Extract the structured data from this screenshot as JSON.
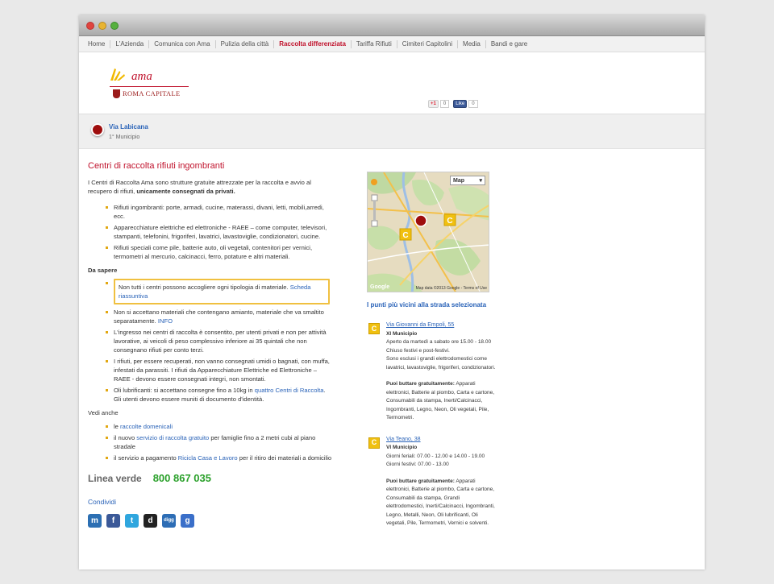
{
  "nav": [
    {
      "label": "Home",
      "active": false
    },
    {
      "label": "L'Azienda",
      "active": false
    },
    {
      "label": "Comunica con Ama",
      "active": false
    },
    {
      "label": "Pulizia della città",
      "active": false
    },
    {
      "label": "Raccolta differenziata",
      "active": true
    },
    {
      "label": "Tariffa Rifiuti",
      "active": false
    },
    {
      "label": "Cimiteri Capitolini",
      "active": false
    },
    {
      "label": "Media",
      "active": false
    },
    {
      "label": "Bandi e gare",
      "active": false
    }
  ],
  "logo": {
    "brand": "ama",
    "city": "ROMA CAPITALE"
  },
  "social_buttons": {
    "gplus_label": "+1",
    "gplus_count": "0",
    "like_label": "Like",
    "like_count": "0"
  },
  "location": {
    "name": "Via Labicana",
    "municipio": "1° Municipio"
  },
  "content": {
    "title": "Centri di raccolta rifiuti ingombranti",
    "intro": "I Centri di Raccolta Ama sono strutture gratuite attrezzate per la raccolta e avvio al recupero di rifiuti, ",
    "intro_bold": "unicamente consegnati da privati.",
    "items": [
      "Rifiuti ingombranti: porte, armadi, cucine, materassi, divani, letti, mobili,arredi, ecc.",
      "Apparecchiature elettriche ed elettroniche - RAEE – come computer, televisori, stampanti, telefonini, frigoriferi, lavatrici, lavastoviglie, condizionatori, cucine.",
      "Rifiuti speciali come pile, batterie auto, oli vegetali, contenitori per vernici, termometri al mercurio, calcinacci, ferro, potature e altri materiali."
    ],
    "da_sapere_label": "Da sapere",
    "notice_text": "Non tutti i centri possono accogliere ogni tipologia di materiale. ",
    "notice_link": "Scheda riassuntiva",
    "sapere_item1_text": "Non si accettano materiali che contengano amianto, materiale che va smaltito separatamente. ",
    "sapere_item1_link": "INFO",
    "sapere_item2": "L'ingresso nei centri di raccolta è consentito, per utenti privati e non per attività lavorative, ai veicoli di peso complessivo inferiore ai 35 quintali che non consegnano rifiuti per conto terzi.",
    "sapere_item3": "I rifiuti, per essere recuperati, non vanno consegnati umidi o bagnati, con muffa, infestati da parassiti. I rifiuti da Apparecchiature Elettriche ed Elettroniche – RAEE - devono essere consegnati integri, non smontati.",
    "sapere_item4_pre": "Oli lubrificanti: si accettano consegne fino a 10kg in ",
    "sapere_item4_link": "quattro Centri di Raccolta",
    "sapere_item4_post": ". Gli utenti devono essere muniti di documento d'identità.",
    "vedi_label": "Vedi anche",
    "vedi_item1_pre": "le ",
    "vedi_item1_link": "raccolte domenicali",
    "vedi_item2_pre": "il nuovo ",
    "vedi_item2_link": "servizio di raccolta gratuito",
    "vedi_item2_post": " per famiglie fino a 2 metri cubi al piano stradale",
    "vedi_item3_pre": "il servizio a pagamento ",
    "vedi_item3_link": "Ricicla Casa e Lavoro",
    "vedi_item3_post": " per il ritiro dei materiali a domicilio",
    "linea_label": "Linea verde",
    "linea_number": "800 867 035",
    "condividi": "Condividi"
  },
  "map": {
    "select_label": "Map",
    "credit": "Map data ©2013 Google - Terms of Use",
    "google": "Google"
  },
  "near_title": "I punti più vicini alla strada selezionata",
  "points": [
    {
      "marker": "C",
      "address": "Via Giovanni da Empoli, 55",
      "municipio": "XI Municipio",
      "hours": [
        "Aperto da martedì a sabato ore 15.00 - 18.00",
        "Chiuso festivi e post-festivi."
      ],
      "note": "Sono esclusi i grandi elettrodomestici come lavatrici, lavastoviglie, frigoriferi, condizionatori.",
      "free_label": "Puoi buttare gratuitamente:",
      "free_text": " Apparati elettronici, Batterie al piombo, Carta e cartone, Consumabili da stampa, Inerti/Calcinacci, Ingombranti, Legno, Neon, Oli vegetali, Pile, Termometri."
    },
    {
      "marker": "C",
      "address": "Via Teano, 38",
      "municipio": "VI Municipio",
      "hours": [
        "Giorni feriali: 07.00 - 12.00 e 14.00 - 19.00",
        "Giorni festivi: 07.00 - 13.00"
      ],
      "free_label": "Puoi buttare gratuitamente:",
      "free_text": " Apparati elettronici, Batterie al piombo, Carta e cartone, Consumabili da stampa, Grandi elettrodomestici, Inerti/Calcinacci, Ingombranti, Legno, Metalli, Neon, Oli lubrificanti, Oli vegetali, Pile, Termometri, Vernici e solventi."
    }
  ],
  "share_icons": [
    {
      "name": "myspace-icon",
      "glyph": "m",
      "color": "#2c6fb3"
    },
    {
      "name": "facebook-icon",
      "glyph": "f",
      "color": "#3b5998"
    },
    {
      "name": "twitter-icon",
      "glyph": "t",
      "color": "#2fa6de"
    },
    {
      "name": "delicious-icon",
      "glyph": "d",
      "color": "#222222"
    },
    {
      "name": "digg-icon",
      "glyph": "digg",
      "color": "#2d6db5"
    },
    {
      "name": "google-icon",
      "glyph": "g",
      "color": "#3a6fc9"
    }
  ],
  "colors": {
    "accent_red": "#c0122c",
    "link_blue": "#2a63b8",
    "green": "#2aa02a",
    "marker_yellow": "#f0c010"
  }
}
